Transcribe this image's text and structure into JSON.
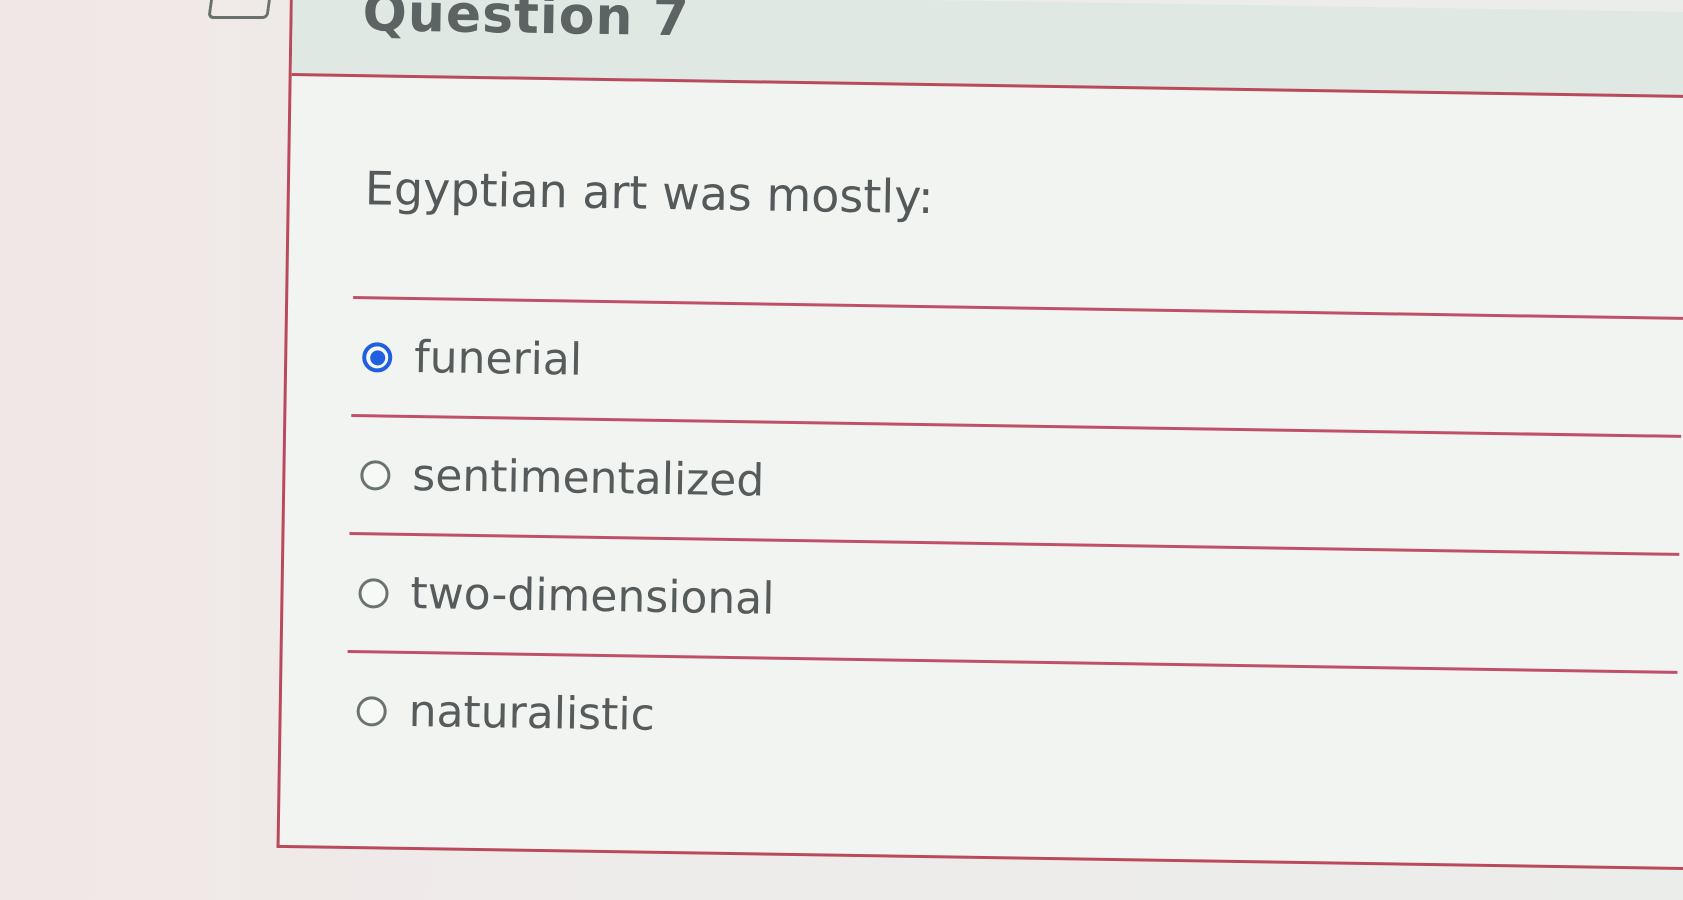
{
  "question": {
    "title": "Question 7",
    "prompt": "Egyptian art was mostly:",
    "selected_index": 0,
    "options": [
      {
        "label": "funerial"
      },
      {
        "label": "sentimentalized"
      },
      {
        "label": "two-dimensional"
      },
      {
        "label": "naturalistic"
      }
    ]
  },
  "colors": {
    "accent": "#1f5fe0",
    "divider": "#c0506a",
    "text": "#565c5b"
  },
  "icons": {
    "header": "flag-icon"
  }
}
